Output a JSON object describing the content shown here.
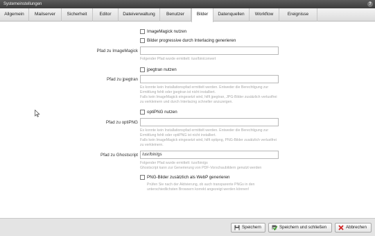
{
  "window": {
    "title": "Systemeinstellungen",
    "help_glyph": "?"
  },
  "tabs": [
    {
      "label": "Allgemein"
    },
    {
      "label": "Mailserver"
    },
    {
      "label": "Sicherheit"
    },
    {
      "label": "Editor"
    },
    {
      "label": "Dateiverwaltung"
    },
    {
      "label": "Benutzer"
    },
    {
      "label": "Bilder"
    },
    {
      "label": "Datenquellen"
    },
    {
      "label": "Workflow"
    },
    {
      "label": "Ereignisse"
    }
  ],
  "active_tab": "Bilder",
  "form": {
    "imagemagick_checkbox": {
      "label": "ImageMagick nutzen",
      "checked": false
    },
    "interlacing_checkbox": {
      "label": "Bilder progressive durch Interlacing generieren",
      "checked": false
    },
    "imagemagick_path": {
      "label": "Pfad zu ImageMagick",
      "value": "",
      "hint": "Folgender Pfad wurde ermittelt: /usr/bin/convert"
    },
    "jpegtran_checkbox": {
      "label": "jpegtran nutzen",
      "checked": false
    },
    "jpegtran_path": {
      "label": "Pfad zu jpegtran",
      "value": "",
      "hint": "Es konnte kein Installationspfad ermittelt werden. Entweder die Berechtigung zur Ermittlung fehlt oder jpegtran ist nicht installiert.\nFalls kein ImageMagick eingesetzt wird, hilft jpegtran, JPG-Bilder zusätzlich verlustfrei zu verkleinern und durch Interlacing schneller anzuzeigen."
    },
    "optipng_checkbox": {
      "label": "optiPNG nutzen",
      "checked": false
    },
    "optipng_path": {
      "label": "Pfad zu optiPNG",
      "value": "",
      "hint": "Es konnte kein Installationspfad ermittelt werden. Entweder die Berechtigung zur Ermittlung fehlt oder optiPNG ist nicht installiert.\nFalls kein ImageMagick eingesetzt wird, hilft optipng, PNG-Bilder zusätzlich verlustfrei zu verkleinern."
    },
    "ghostscript_path": {
      "label": "Pfad zu Ghostscript",
      "value": "/usr/bin/gs",
      "hint": "Folgender Pfad wurde ermittelt: /usr/bin/gs\nGhostscript kann zur Generierung von PDF-Vorschaubildern genutzt werden"
    },
    "webp_checkbox": {
      "label": "PNG-Bilder zusätzlich als WebP generieren",
      "checked": false,
      "hint": "Prüfen Sie nach der Aktivierung, ob auch transparente PNGs in den unterschiedlichsten Browsern korrekt angezeigt werden können!"
    }
  },
  "footer": {
    "save_label": "Speichern",
    "save_close_label": "Speichern und schließen",
    "cancel_label": "Abbrechen"
  },
  "colors": {
    "cancel_icon": "#d22020",
    "save_close_icon": "#3a9a2a",
    "save_icon": "#3a3a3a"
  }
}
